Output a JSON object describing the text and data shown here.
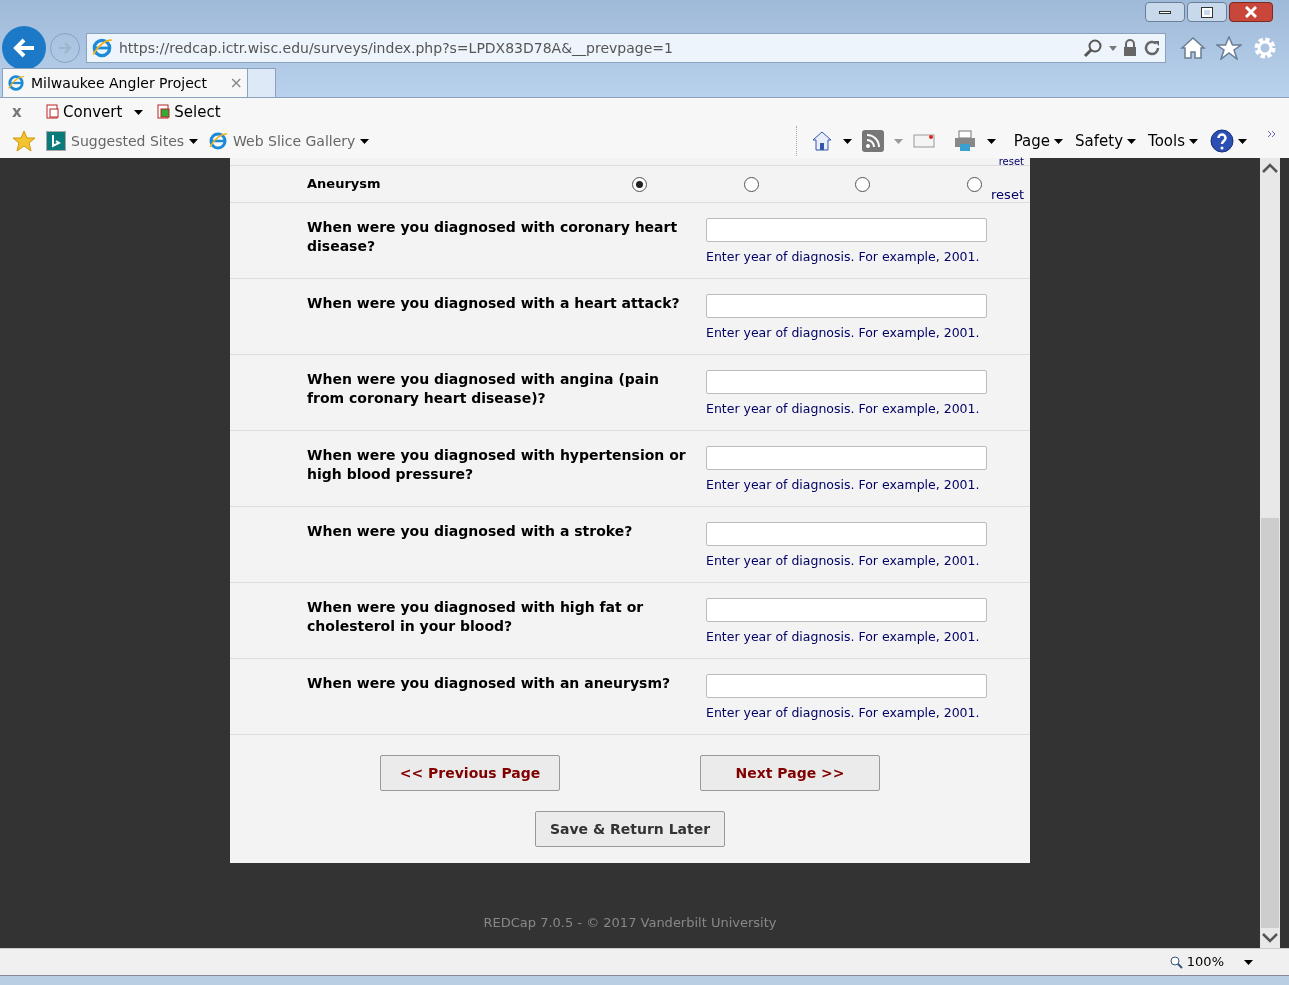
{
  "browser": {
    "url": "https://redcap.ictr.wisc.edu/surveys/index.php?s=LPDX83D78A&__prevpage=1",
    "tab_title": "Milwaukee Angler Project",
    "close_tab": "×",
    "close_bar": "x",
    "pdf_tools": [
      "Convert",
      "Select"
    ],
    "favorites": [
      "Suggested Sites",
      "Web Slice Gallery"
    ],
    "menus": [
      "Page",
      "Safety",
      "Tools"
    ],
    "zoom": "100%"
  },
  "matrix_row": {
    "top_reset": "reset",
    "label": "Aneurysm",
    "options": [
      {
        "selected": true
      },
      {
        "selected": false
      },
      {
        "selected": false
      },
      {
        "selected": false
      }
    ],
    "reset": "reset"
  },
  "questions": [
    {
      "text": "When were you diagnosed with coronary heart disease?",
      "note": "Enter year of diagnosis. For example, 2001."
    },
    {
      "text": "When were you diagnosed with a heart attack?",
      "note": "Enter year of diagnosis. For example, 2001."
    },
    {
      "text": "When were you diagnosed with angina (pain from coronary heart disease)?",
      "note": "Enter year of diagnosis. For example, 2001."
    },
    {
      "text": "When were you diagnosed with hypertension or high blood pressure?",
      "note": "Enter year of diagnosis. For example, 2001."
    },
    {
      "text": "When were you diagnosed with a stroke?",
      "note": "Enter year of diagnosis. For example, 2001."
    },
    {
      "text": "When were you diagnosed with high fat or cholesterol in your blood?",
      "note": "Enter year of diagnosis. For example, 2001."
    },
    {
      "text": "When were you diagnosed with an aneurysm?",
      "note": "Enter year of diagnosis. For example, 2001."
    }
  ],
  "buttons": {
    "previous": "<< Previous Page",
    "next": "Next Page >>",
    "save": "Save & Return Later"
  },
  "footer": "REDCap 7.0.5 - © 2017 Vanderbilt University"
}
